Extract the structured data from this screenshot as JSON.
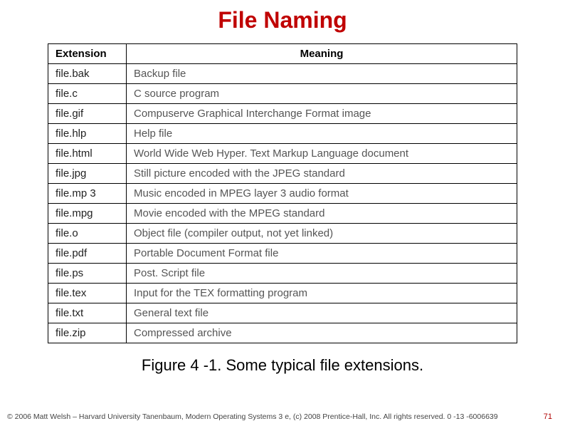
{
  "title": "File Naming",
  "table": {
    "headers": {
      "extension": "Extension",
      "meaning": "Meaning"
    },
    "rows": [
      {
        "extension": "file.bak",
        "meaning": "Backup file"
      },
      {
        "extension": "file.c",
        "meaning": "C source program"
      },
      {
        "extension": "file.gif",
        "meaning": "Compuserve Graphical Interchange Format image"
      },
      {
        "extension": "file.hlp",
        "meaning": "Help file"
      },
      {
        "extension": "file.html",
        "meaning": "World Wide Web Hyper. Text Markup Language document"
      },
      {
        "extension": "file.jpg",
        "meaning": "Still picture encoded with the JPEG standard"
      },
      {
        "extension": "file.mp 3",
        "meaning": "Music encoded in MPEG layer 3 audio format"
      },
      {
        "extension": "file.mpg",
        "meaning": "Movie encoded with the MPEG standard"
      },
      {
        "extension": "file.o",
        "meaning": "Object file (compiler output, not yet linked)"
      },
      {
        "extension": "file.pdf",
        "meaning": "Portable Document Format file"
      },
      {
        "extension": "file.ps",
        "meaning": "Post. Script file"
      },
      {
        "extension": "file.tex",
        "meaning": "Input for the TEX formatting program"
      },
      {
        "extension": "file.txt",
        "meaning": "General text file"
      },
      {
        "extension": "file.zip",
        "meaning": "Compressed archive"
      }
    ]
  },
  "caption": "Figure 4 -1. Some typical file extensions.",
  "footer": {
    "line": "© 2006 Matt Welsh – Harvard University  Tanenbaum, Modern Operating Systems 3 e, (c) 2008 Prentice-Hall, Inc. All rights reserved. 0 -13 -6006639",
    "pagenum": "71"
  }
}
